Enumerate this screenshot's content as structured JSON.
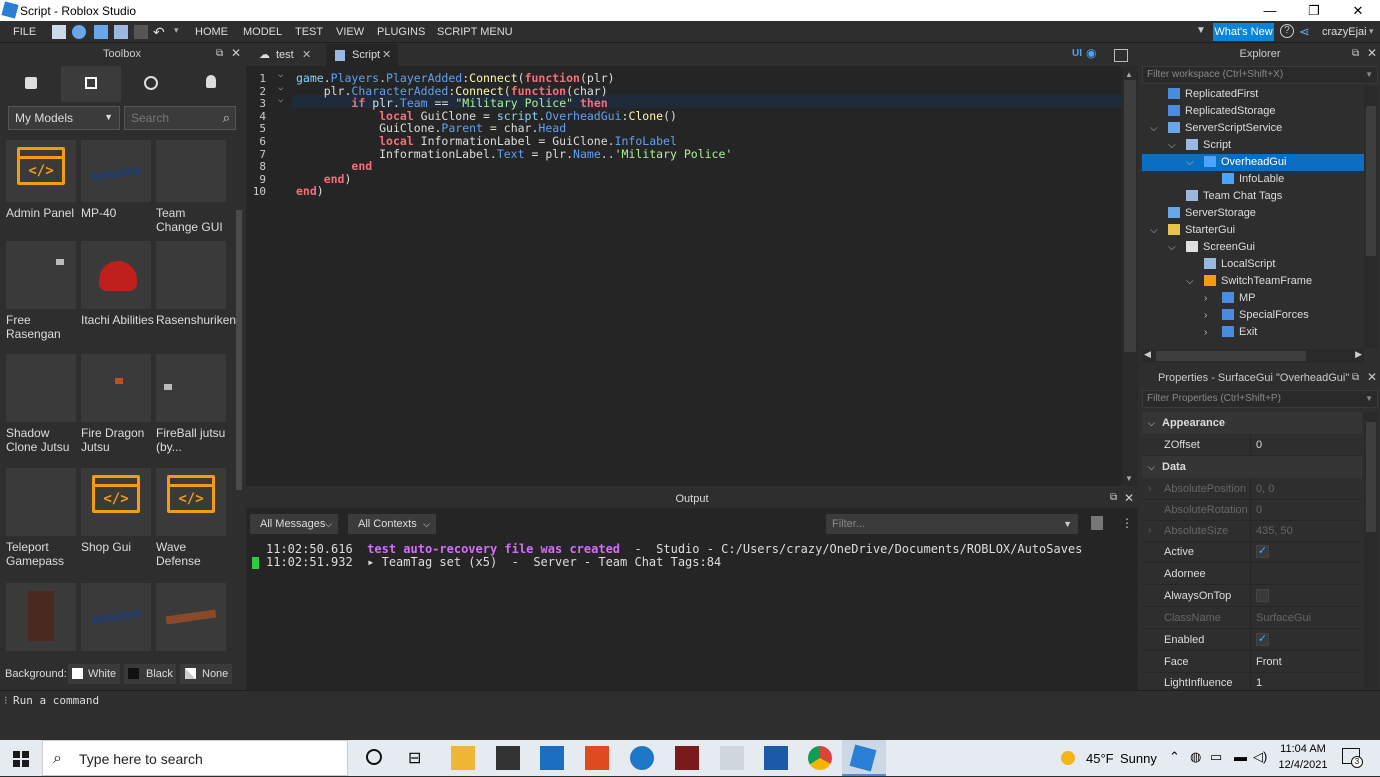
{
  "window": {
    "title": "Script - Roblox Studio",
    "controls": [
      "—",
      "❐",
      "✕"
    ]
  },
  "menu": {
    "items": [
      "FILE",
      "HOME",
      "MODEL",
      "TEST",
      "VIEW",
      "PLUGINS",
      "SCRIPT MENU"
    ],
    "whats_new": "What's New",
    "user": "crazyEjai"
  },
  "toolbox": {
    "title": "Toolbox",
    "category": "My Models",
    "search_placeholder": "Search",
    "items": [
      {
        "label": "Admin Panel",
        "icon": "code"
      },
      {
        "label": "MP-40",
        "icon": "gun"
      },
      {
        "label": "Team Change GUI",
        "icon": "blank"
      },
      {
        "label": "Free Rasengan",
        "icon": "orb"
      },
      {
        "label": "Itachi Abilities",
        "icon": "hat"
      },
      {
        "label": "Rasenshuriken",
        "icon": "blank"
      },
      {
        "label": "Shadow Clone Jutsu",
        "icon": "blank"
      },
      {
        "label": "Fire Dragon Jutsu",
        "icon": "dot"
      },
      {
        "label": "FireBall jutsu (by...",
        "icon": "hand"
      },
      {
        "label": "Teleport Gamepass",
        "icon": "blank"
      },
      {
        "label": "Shop Gui",
        "icon": "code"
      },
      {
        "label": "Wave Defense",
        "icon": "code"
      },
      {
        "label": "",
        "icon": "char"
      },
      {
        "label": "",
        "icon": "rifle"
      },
      {
        "label": "",
        "icon": "rifle2"
      }
    ],
    "bg_label": "Background:",
    "bg_options": [
      "White",
      "Black",
      "None"
    ]
  },
  "editor": {
    "tabs": [
      "test",
      "Script"
    ],
    "line_numbers": [
      "1",
      "2",
      "3",
      "4",
      "5",
      "6",
      "7",
      "8",
      "9",
      "10"
    ],
    "code_text": [
      "game.Players.PlayerAdded:Connect(function(plr)",
      "    plr.CharacterAdded:Connect(function(char)",
      "        if plr.Team == \"Military Police\" then",
      "            local GuiClone = script.OverheadGui:Clone()",
      "            GuiClone.Parent = char.Head",
      "            local InformationLabel = GuiClone.InfoLabel",
      "            InformationLabel.Text = plr.Name..'Military Police'",
      "        end",
      "    end)",
      "end)"
    ]
  },
  "output": {
    "title": "Output",
    "filter1": "All Messages",
    "filter2": "All Contexts",
    "filter_placeholder": "Filter...",
    "lines": [
      {
        "time": "11:02:50.616",
        "msg": "test auto-recovery file was created",
        "rest": "  -  Studio - C:/Users/crazy/OneDrive/Documents/ROBLOX/AutoSaves"
      },
      {
        "time": "11:02:51.932",
        "msg": "▸ TeamTag set (x5)",
        "rest": "  -  Server - Team Chat Tags:84"
      }
    ]
  },
  "explorer": {
    "title": "Explorer",
    "filter": "Filter workspace (Ctrl+Shift+X)",
    "rows": [
      {
        "label": "ReplicatedFirst",
        "indent": 0,
        "chev": "",
        "icon": "#4a8de0"
      },
      {
        "label": "ReplicatedStorage",
        "indent": 0,
        "chev": "",
        "icon": "#4a8de0"
      },
      {
        "label": "ServerScriptService",
        "indent": 0,
        "chev": "v",
        "icon": "#6aa7e8"
      },
      {
        "label": "Script",
        "indent": 1,
        "chev": "v",
        "icon": "#9ab8e0"
      },
      {
        "label": "OverheadGui",
        "indent": 2,
        "chev": "v",
        "icon": "#4aa3ff",
        "sel": true
      },
      {
        "label": "InfoLable",
        "indent": 3,
        "chev": "",
        "icon": "#4aa3ff"
      },
      {
        "label": "Team Chat Tags",
        "indent": 1,
        "chev": "",
        "icon": "#9ab8e0"
      },
      {
        "label": "ServerStorage",
        "indent": 0,
        "chev": "",
        "icon": "#6aa7e8"
      },
      {
        "label": "StarterGui",
        "indent": 0,
        "chev": "v",
        "icon": "#e8c24a"
      },
      {
        "label": "ScreenGui",
        "indent": 1,
        "chev": "v",
        "icon": "#e0e0e0"
      },
      {
        "label": "LocalScript",
        "indent": 2,
        "chev": "",
        "icon": "#9ab8e0"
      },
      {
        "label": "SwitchTeamFrame",
        "indent": 2,
        "chev": "v",
        "icon": "#f39c12"
      },
      {
        "label": "MP",
        "indent": 3,
        "chev": ">",
        "icon": "#4a8de0"
      },
      {
        "label": "SpecialForces",
        "indent": 3,
        "chev": ">",
        "icon": "#4a8de0"
      },
      {
        "label": "Exit",
        "indent": 3,
        "chev": ">",
        "icon": "#4a8de0"
      }
    ]
  },
  "properties": {
    "title": "Properties - SurfaceGui \"OverheadGui\"",
    "filter": "Filter Properties (Ctrl+Shift+P)",
    "rows": [
      {
        "type": "cat",
        "name": "Appearance"
      },
      {
        "type": "prop",
        "name": "ZOffset",
        "value": "0"
      },
      {
        "type": "cat",
        "name": "Data"
      },
      {
        "type": "prop",
        "name": "AbsolutePosition",
        "value": "0, 0",
        "dim": true,
        "chev": true
      },
      {
        "type": "prop",
        "name": "AbsoluteRotation",
        "value": "0",
        "dim": true
      },
      {
        "type": "prop",
        "name": "AbsoluteSize",
        "value": "435, 50",
        "dim": true,
        "chev": true
      },
      {
        "type": "prop",
        "name": "Active",
        "check": "on"
      },
      {
        "type": "prop",
        "name": "Adornee",
        "value": ""
      },
      {
        "type": "prop",
        "name": "AlwaysOnTop",
        "check": "off"
      },
      {
        "type": "prop",
        "name": "ClassName",
        "value": "SurfaceGui",
        "dim": true
      },
      {
        "type": "prop",
        "name": "Enabled",
        "check": "on"
      },
      {
        "type": "prop",
        "name": "Face",
        "value": "Front"
      },
      {
        "type": "prop",
        "name": "LightInfluence",
        "value": "1"
      }
    ]
  },
  "command": {
    "placeholder": "Run a command"
  },
  "taskbar": {
    "search": "Type here to search",
    "weather_temp": "45°F",
    "weather": "Sunny",
    "time": "11:04 AM",
    "date": "12/4/2021",
    "notif": "3"
  }
}
